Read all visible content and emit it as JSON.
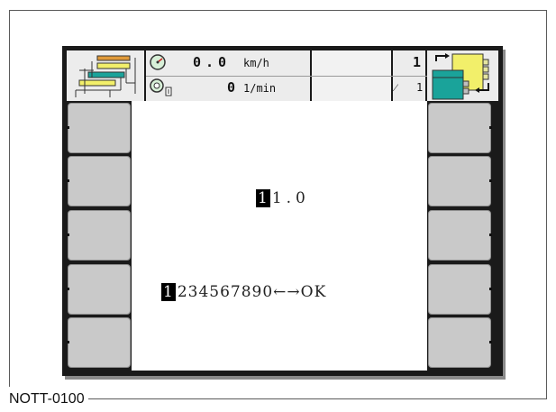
{
  "caption": "NOTT-0100",
  "header": {
    "speed_value": "0.0",
    "speed_unit": "km/h",
    "rpm_value": "0",
    "rpm_unit": "1/min",
    "count_top": "1",
    "count_bottom_prefix": "⁄",
    "count_bottom": "1"
  },
  "display": {
    "entry_cursor": "1",
    "entry_rest": "1.0",
    "keypad_cursor": "1",
    "keypad_rest": "234567890←→OK"
  },
  "icons": {
    "machine": "machine-layout-icon",
    "speedometer": "speedometer-icon",
    "rpm": "rpm-sensor-icon",
    "section_control": "section-return-icon"
  },
  "colors": {
    "softkey": "#c9c9c9",
    "frame": "#1a1a1a",
    "icon_teal": "#1aa39a",
    "icon_yellow": "#f2ef6a",
    "icon_orange": "#e09a3a"
  }
}
